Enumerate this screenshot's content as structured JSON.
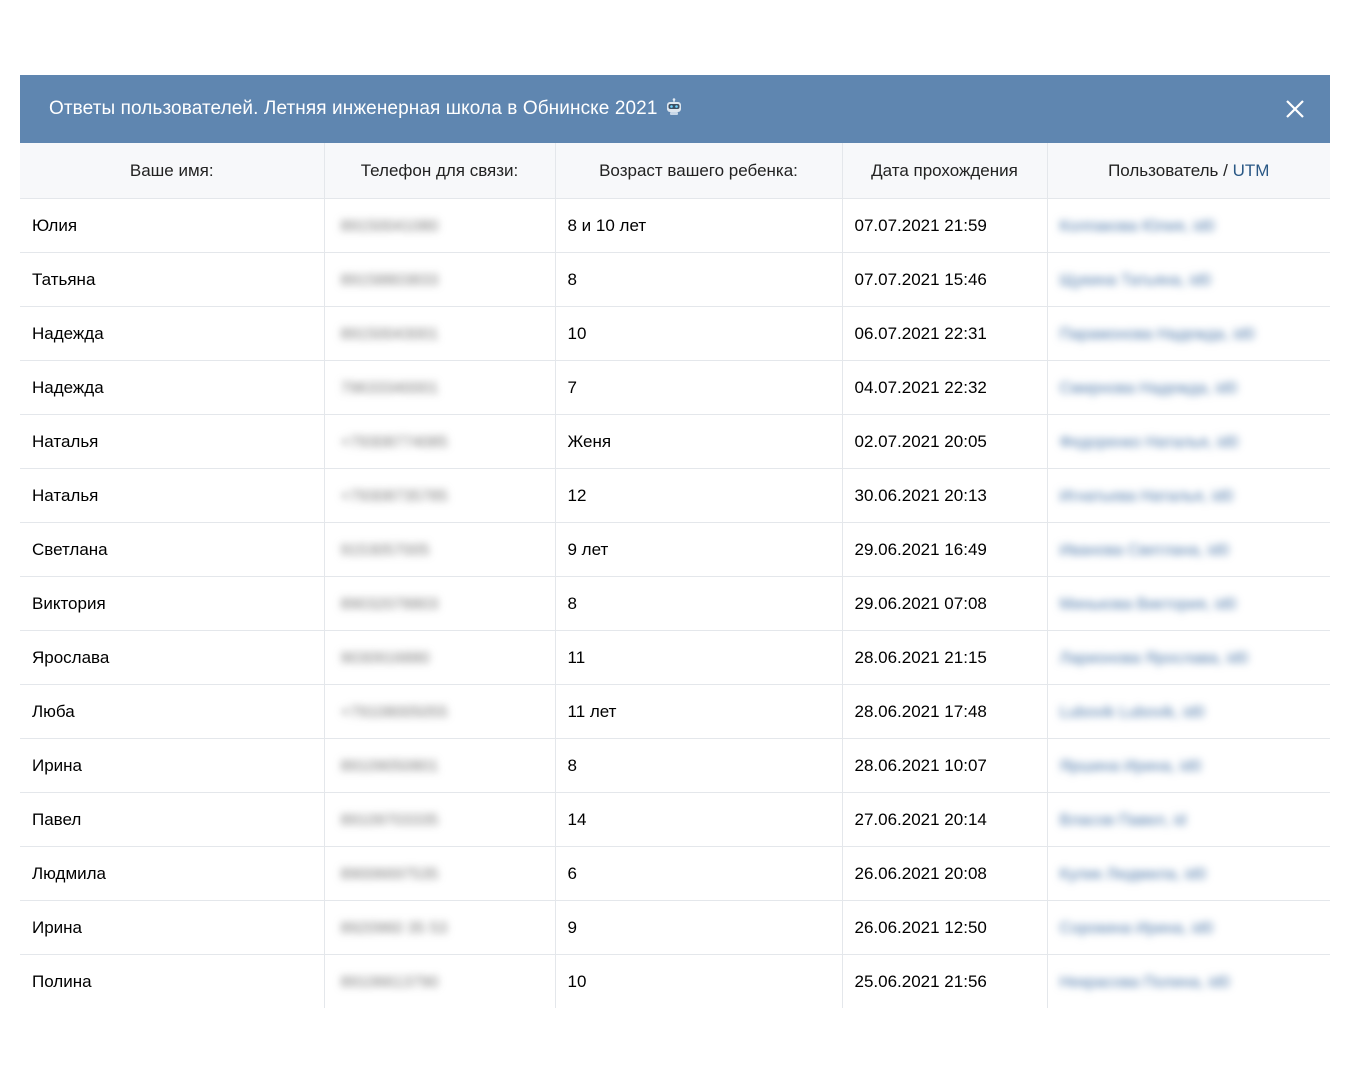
{
  "dialog": {
    "title": "Ответы пользователей. Летняя инженерная школа в Обнинске 2021"
  },
  "table": {
    "headers": {
      "name": "Ваше имя:",
      "phone": "Телефон для связи:",
      "age": "Возраст вашего ребенка:",
      "date": "Дата прохождения",
      "user": "Пользователь / ",
      "utm": "UTM"
    },
    "rows": [
      {
        "name": "Юлия",
        "phone": "89150041080",
        "age": "8 и 10 лет",
        "date": "07.07.2021 21:59",
        "user": "Колпакова Юлия, id0"
      },
      {
        "name": "Татьяна",
        "phone": "89158803833",
        "age": "8",
        "date": "07.07.2021 15:46",
        "user": "Щукина Татьяна, id0"
      },
      {
        "name": "Надежда",
        "phone": "89150043001",
        "age": "10",
        "date": "06.07.2021 22:31",
        "user": "Парамонова Надежда, id0"
      },
      {
        "name": "Надежда",
        "phone": "79633340001",
        "age": "7",
        "date": "04.07.2021 22:32",
        "user": "Смирнова Надежда, id0"
      },
      {
        "name": "Наталья",
        "phone": "+79308774085",
        "age": "Женя",
        "date": "02.07.2021 20:05",
        "user": "Федоренко Наталья, id0"
      },
      {
        "name": "Наталья",
        "phone": "+79308735785",
        "age": "12",
        "date": "30.06.2021 20:13",
        "user": "Игнатьева Наталья, id0"
      },
      {
        "name": "Светлана",
        "phone": "9153057005",
        "age": "9 лет",
        "date": "29.06.2021 16:49",
        "user": "Иванова Светлана, id0"
      },
      {
        "name": "Виктория",
        "phone": "89032078803",
        "age": "8",
        "date": "29.06.2021 07:08",
        "user": "Минькова Виктория, id0"
      },
      {
        "name": "Ярослава",
        "phone": "9030916880",
        "age": "11",
        "date": "28.06.2021 21:15",
        "user": "Ларионова Ярослава, id0"
      },
      {
        "name": "Люба",
        "phone": "+79108005055",
        "age": "11 лет",
        "date": "28.06.2021 17:48",
        "user": "Lubovik Lubovik, id0"
      },
      {
        "name": "Ирина",
        "phone": "89109050801",
        "age": "8",
        "date": "28.06.2021 10:07",
        "user": "Яршина Ирина, id0"
      },
      {
        "name": "Павел",
        "phone": "89109703335",
        "age": "14",
        "date": "27.06.2021 20:14",
        "user": "Власов Павел, id"
      },
      {
        "name": "Людмила",
        "phone": "89006697535",
        "age": "6",
        "date": "26.06.2021 20:08",
        "user": "Кулик Людмила, id0"
      },
      {
        "name": "Ирина",
        "phone": "8920960 35 53",
        "age": "9",
        "date": "26.06.2021 12:50",
        "user": "Сорокина Ирина, id0"
      },
      {
        "name": "Полина",
        "phone": "89106613790",
        "age": "10",
        "date": "25.06.2021 21:56",
        "user": "Некрасова Полина, id0"
      }
    ]
  }
}
